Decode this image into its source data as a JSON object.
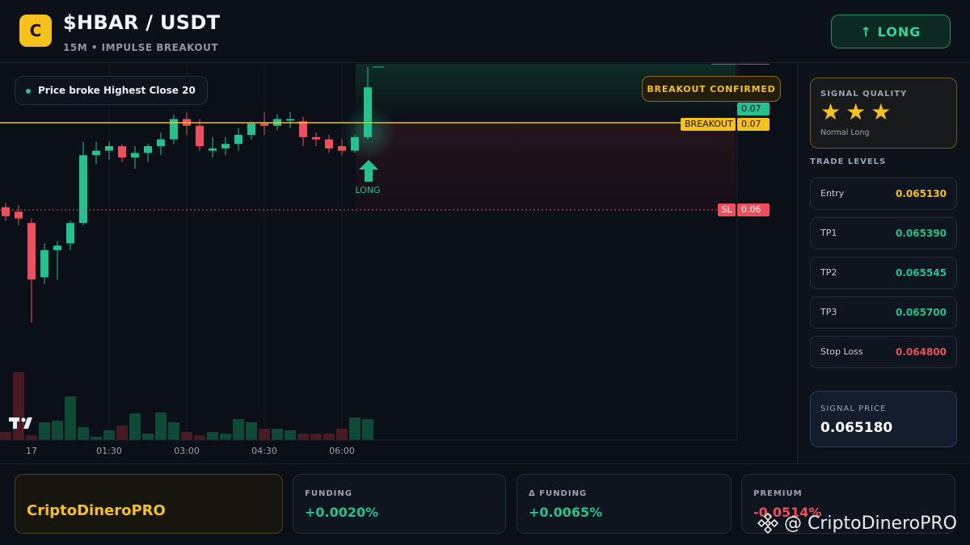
{
  "header": {
    "logo_letter": "C",
    "title": "$HBAR / USDT",
    "subtitle": "15M • IMPULSE BREAKOUT",
    "long_button": "↑ LONG"
  },
  "chart": {
    "price_broke_label": "Price broke Highest Close 20",
    "breakout_confirmed": "BREAKOUT CONFIRMED",
    "long_marker": "LONG",
    "current_price_tag": "0.07",
    "breakout_tag_label": "BREAKOUT",
    "breakout_tag_value": "0.07",
    "sl_tag_label": "SL",
    "sl_tag_value": "0.06",
    "x_ticks": [
      "17",
      "01:30",
      "03:00",
      "04:30",
      "06:00"
    ],
    "tv_logo": "TV"
  },
  "chart_data": {
    "type": "candlestick",
    "x_ticks": [
      "17",
      "01:30",
      "03:00",
      "04:30",
      "06:00"
    ],
    "breakout_level": 0.07,
    "stop_loss": 0.06,
    "candles": [
      {
        "o": 0.06476,
        "h": 0.0648,
        "l": 0.06464,
        "c": 0.06468
      },
      {
        "o": 0.06472,
        "h": 0.06478,
        "l": 0.0646,
        "c": 0.06466
      },
      {
        "o": 0.06462,
        "h": 0.06466,
        "l": 0.06374,
        "c": 0.06412
      },
      {
        "o": 0.06414,
        "h": 0.06444,
        "l": 0.06408,
        "c": 0.06438
      },
      {
        "o": 0.06438,
        "h": 0.06446,
        "l": 0.06412,
        "c": 0.06442
      },
      {
        "o": 0.06444,
        "h": 0.06464,
        "l": 0.06438,
        "c": 0.06462
      },
      {
        "o": 0.06462,
        "h": 0.06534,
        "l": 0.0646,
        "c": 0.06522
      },
      {
        "o": 0.06522,
        "h": 0.06534,
        "l": 0.06514,
        "c": 0.06526
      },
      {
        "o": 0.06526,
        "h": 0.06534,
        "l": 0.06518,
        "c": 0.0653
      },
      {
        "o": 0.0653,
        "h": 0.06532,
        "l": 0.06516,
        "c": 0.0652
      },
      {
        "o": 0.0652,
        "h": 0.0653,
        "l": 0.0651,
        "c": 0.06524
      },
      {
        "o": 0.06524,
        "h": 0.06532,
        "l": 0.06516,
        "c": 0.0653
      },
      {
        "o": 0.0653,
        "h": 0.06542,
        "l": 0.06522,
        "c": 0.06536
      },
      {
        "o": 0.06536,
        "h": 0.06558,
        "l": 0.06532,
        "c": 0.06554
      },
      {
        "o": 0.06554,
        "h": 0.0656,
        "l": 0.0654,
        "c": 0.06548
      },
      {
        "o": 0.06548,
        "h": 0.06554,
        "l": 0.06526,
        "c": 0.0653
      },
      {
        "o": 0.06526,
        "h": 0.06538,
        "l": 0.0652,
        "c": 0.06528
      },
      {
        "o": 0.06528,
        "h": 0.06538,
        "l": 0.06522,
        "c": 0.06532
      },
      {
        "o": 0.06532,
        "h": 0.06546,
        "l": 0.06526,
        "c": 0.0654
      },
      {
        "o": 0.0654,
        "h": 0.06552,
        "l": 0.06536,
        "c": 0.0655
      },
      {
        "o": 0.0655,
        "h": 0.0656,
        "l": 0.0654,
        "c": 0.06548
      },
      {
        "o": 0.06548,
        "h": 0.06558,
        "l": 0.06544,
        "c": 0.06554
      },
      {
        "o": 0.06554,
        "h": 0.0656,
        "l": 0.06546,
        "c": 0.06554
      },
      {
        "o": 0.06552,
        "h": 0.06556,
        "l": 0.0653,
        "c": 0.06538
      },
      {
        "o": 0.06538,
        "h": 0.06542,
        "l": 0.0653,
        "c": 0.06536
      },
      {
        "o": 0.06536,
        "h": 0.0654,
        "l": 0.06524,
        "c": 0.06528
      },
      {
        "o": 0.0653,
        "h": 0.06536,
        "l": 0.06522,
        "c": 0.06526
      },
      {
        "o": 0.06526,
        "h": 0.0654,
        "l": 0.06524,
        "c": 0.06538
      },
      {
        "o": 0.06538,
        "h": 0.066,
        "l": 0.06536,
        "c": 0.06582
      }
    ],
    "volume_colors": [
      "#ef4f5d",
      "#22c38e"
    ]
  },
  "sidebar": {
    "quality_title": "SIGNAL QUALITY",
    "stars": "★ ★ ★",
    "quality_sub": "Normal Long",
    "trade_levels_title": "TRADE LEVELS",
    "levels": [
      {
        "label": "Entry",
        "value": "0.065130",
        "color": "#f5c21b"
      },
      {
        "label": "TP1",
        "value": "0.065390",
        "color": "#22c38e"
      },
      {
        "label": "TP2",
        "value": "0.065545",
        "color": "#22c38e"
      },
      {
        "label": "TP3",
        "value": "0.065700",
        "color": "#22c38e"
      },
      {
        "label": "Stop Loss",
        "value": "0.064800",
        "color": "#ef4f5d"
      }
    ],
    "signal_price_title": "SIGNAL PRICE",
    "signal_price": "0.065180"
  },
  "bottom": {
    "brand": "CriptoDineroPRO",
    "metrics": [
      {
        "label": "FUNDING",
        "value": "+0.0020%",
        "color": "#22c38e"
      },
      {
        "label": "Δ FUNDING",
        "value": "+0.0065%",
        "color": "#22c38e"
      },
      {
        "label": "PREMIUM",
        "value": "-0.0514%",
        "color": "#ef4f5d"
      }
    ],
    "watermark": "@ CriptoDineroPRO"
  },
  "colors": {
    "up": "#22c38e",
    "down": "#ef4f5d",
    "accent": "#f5c21b"
  }
}
